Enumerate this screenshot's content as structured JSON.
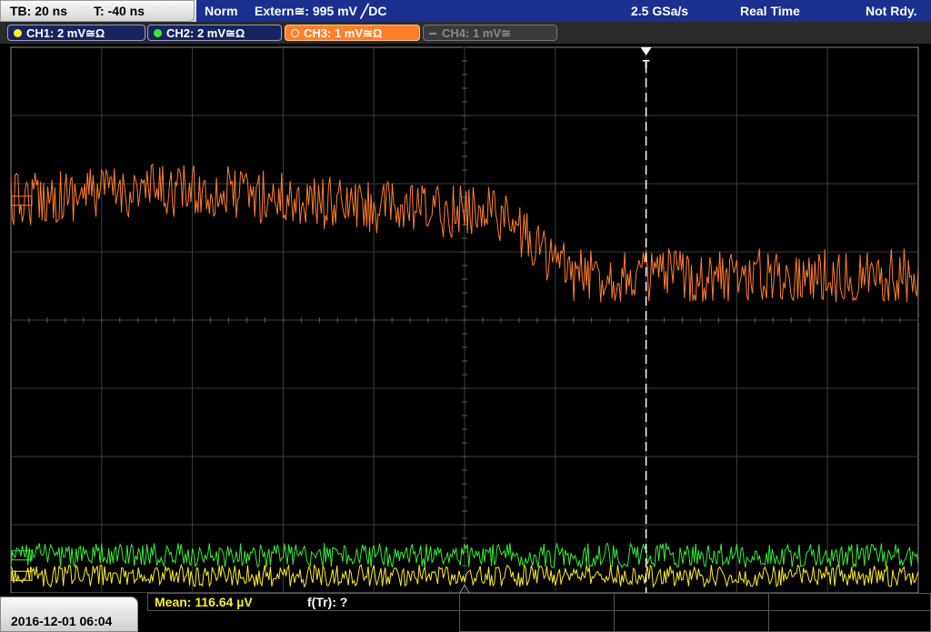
{
  "status": {
    "timebase": "TB: 20 ns",
    "trigger_time": "T: -40 ns",
    "mode": "Norm",
    "trigger_source": "Extern≅: 995 mV ╱DC",
    "sample_rate": "2.5 GSa/s",
    "acq_mode": "Real Time",
    "state": "Not Rdy."
  },
  "channels": [
    {
      "label": "CH1: 2 mV≅Ω",
      "color": "#ffee22",
      "active": true
    },
    {
      "label": "CH2: 2 mV≅Ω",
      "color": "#33ee33",
      "active": true
    },
    {
      "label": "CH3: 1 mV≅Ω",
      "color": "#ff7f2a",
      "active": true,
      "selected": true
    },
    {
      "label": "CH4: 1 mV≅",
      "color": "#8a8a8a",
      "active": false
    }
  ],
  "trigger_marker": "T",
  "measurements": {
    "mean": "Mean: 116.64 µV",
    "ftr": "f(Tr): ?"
  },
  "datetime": "2016-12-01 06:04",
  "chart_data": {
    "type": "line",
    "x_divisions": 10,
    "y_divisions": 8,
    "time_per_div_ns": 20,
    "trigger_x_div": 7,
    "series": [
      {
        "name": "CH3",
        "color": "#ff7f2a",
        "level_start_div": 2.25,
        "level_end_div": 3.35,
        "step_at_div": 5.2,
        "noise_div": 0.4
      },
      {
        "name": "CH2",
        "color": "#33ee33",
        "level_start_div": 7.45,
        "level_end_div": 7.45,
        "noise_div": 0.18
      },
      {
        "name": "CH1",
        "color": "#ffee22",
        "level_start_div": 7.75,
        "level_end_div": 7.75,
        "noise_div": 0.16
      }
    ]
  }
}
